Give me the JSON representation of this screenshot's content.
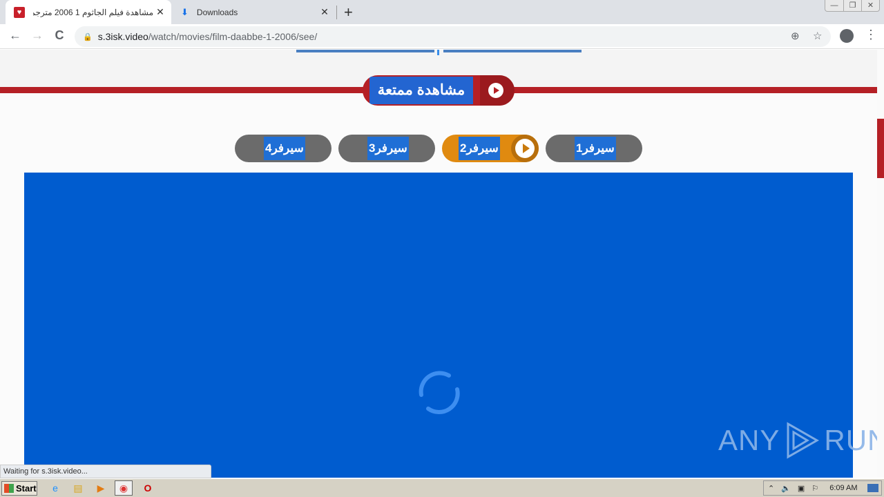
{
  "browser": {
    "tabs": [
      {
        "title": "مشاهدة فيلم الجاثوم 1 2006 مترجم",
        "active": true,
        "icon": "heart-favicon"
      },
      {
        "title": "Downloads",
        "active": false,
        "icon": "download-icon"
      }
    ],
    "new_tab_label": "+",
    "window_controls": {
      "minimize": "—",
      "restore": "❐",
      "close": "✕"
    },
    "nav": {
      "back": "←",
      "forward": "→",
      "reload": "C"
    },
    "url_host": "s.3isk.video",
    "url_path": "/watch/movies/film-daabbe-1-2006/see/",
    "lock_icon": "🔒",
    "add_icon": "⊕",
    "star_icon": "☆",
    "menu_icon": "⋮"
  },
  "page": {
    "hero_label": "مشاهدة ممتعة",
    "servers": [
      {
        "label": "سيرفر1",
        "active": false
      },
      {
        "label": "سيرفر2",
        "active": true
      },
      {
        "label": "سيرفر3",
        "active": false
      },
      {
        "label": "سيرفر4",
        "active": false
      }
    ],
    "watermark_left": "ANY",
    "watermark_right": "RUN",
    "colors": {
      "accent_red": "#b52025",
      "player_blue": "#005ccf",
      "active_orange": "#e08a10"
    }
  },
  "status_text": "Waiting for s.3isk.video...",
  "taskbar": {
    "start_label": "Start",
    "clock": "6:09 AM"
  }
}
